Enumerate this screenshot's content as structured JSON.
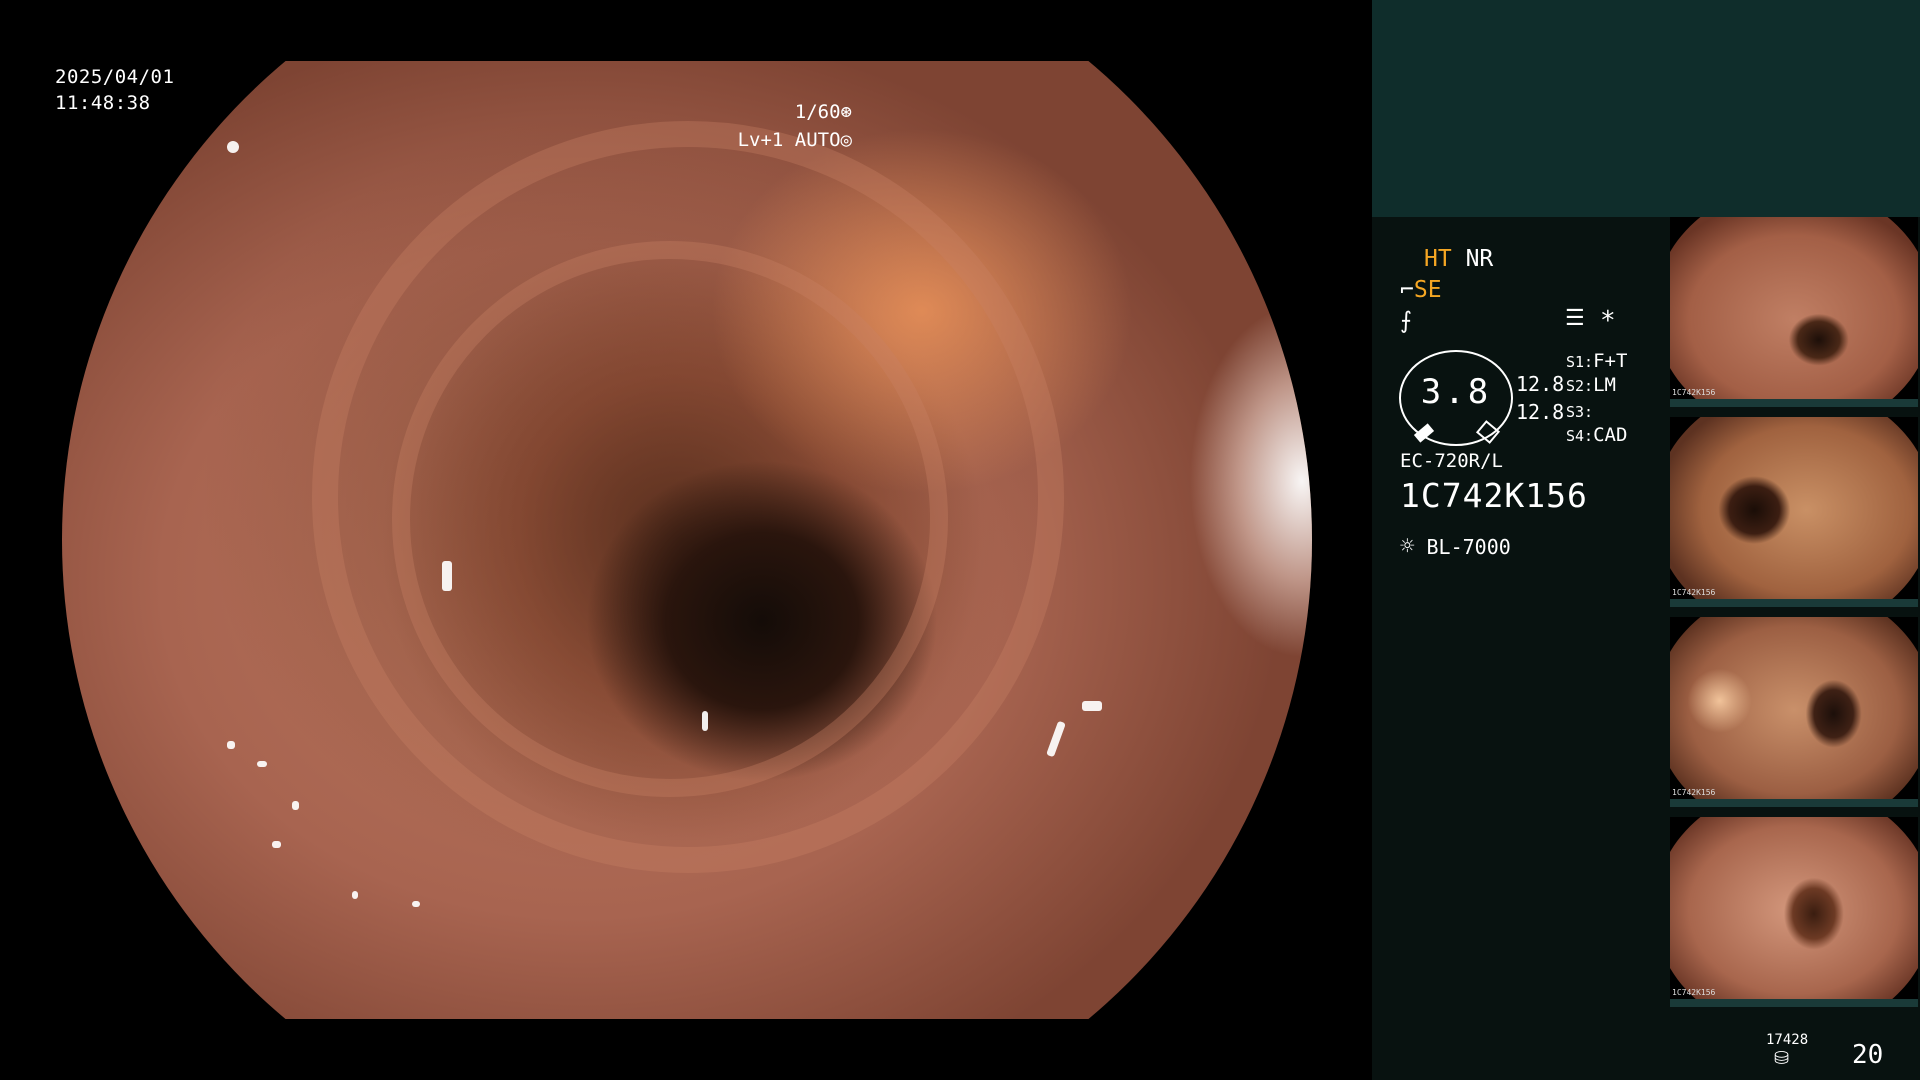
{
  "osd": {
    "date": "2025/04/01",
    "time": "11:48:38",
    "shutter": "1/60",
    "shutter_icon": "aperture-icon",
    "level": "Lv+1 AUTO",
    "level_icon": "iris-icon"
  },
  "panel": {
    "ht": "HT",
    "nr": "NR",
    "se": "SE",
    "se_icon": "structure-enhance-icon",
    "color_icon": "color-mode-icon",
    "menu_icon": "menu-icon",
    "asterisk": "*",
    "gauge_value": "3.8",
    "value_top": "12.8",
    "value_bottom": "12.8",
    "s1": "S1:",
    "s1_val": "F+T",
    "s2": "S2:",
    "s2_val": "LM",
    "s3": "S3:",
    "s3_val": "",
    "s4": "S4:",
    "s4_val": "CAD",
    "scope_model": "EC-720R/L",
    "scope_serial": "1C742K156",
    "light_icon": "light-source-icon",
    "light_source": "BL-7000",
    "storage_count": "17428",
    "storage_icon": "storage-icon",
    "image_count": "20"
  },
  "thumbnails": [
    {
      "label": "1C742K156"
    },
    {
      "label": "1C742K156"
    },
    {
      "label": "1C742K156"
    },
    {
      "label": "1C742K156"
    }
  ],
  "colors": {
    "accent": "#f5a623",
    "panel_bg": "#081210",
    "panel_header": "#0f2d2b"
  }
}
